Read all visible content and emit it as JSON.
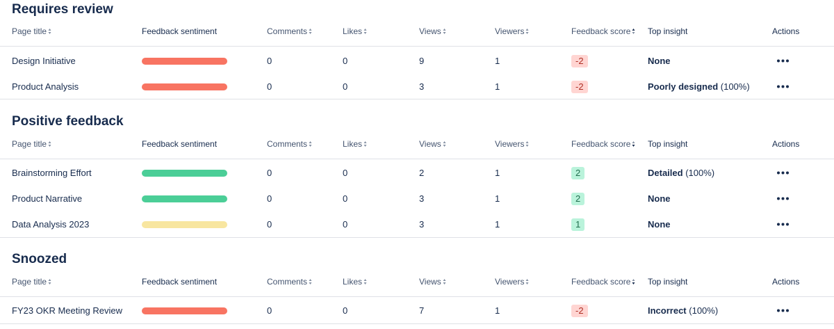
{
  "columns": {
    "page_title": "Page title",
    "feedback_sentiment": "Feedback sentiment",
    "comments": "Comments",
    "likes": "Likes",
    "views": "Views",
    "viewers": "Viewers",
    "feedback_score": "Feedback score",
    "top_insight": "Top insight",
    "actions": "Actions"
  },
  "colors": {
    "negative": "#f87462",
    "positive": "#4bce97",
    "neutral": "#f8e6a0",
    "badge_negative_bg": "#ffd5d2",
    "badge_positive_bg": "#baf3db"
  },
  "icons": {
    "sort": "sort-icon",
    "more": "more-horizontal-icon"
  },
  "sections": [
    {
      "title": "Requires review",
      "rows": [
        {
          "page_title": "Design Initiative",
          "sentiment": "negative",
          "comments": "0",
          "likes": "0",
          "views": "9",
          "viewers": "1",
          "score": "-2",
          "insight": "None",
          "insight_pct": ""
        },
        {
          "page_title": "Product Analysis",
          "sentiment": "negative",
          "comments": "0",
          "likes": "0",
          "views": "3",
          "viewers": "1",
          "score": "-2",
          "insight": "Poorly designed",
          "insight_pct": "(100%)"
        }
      ]
    },
    {
      "title": "Positive feedback",
      "rows": [
        {
          "page_title": "Brainstorming Effort",
          "sentiment": "positive",
          "comments": "0",
          "likes": "0",
          "views": "2",
          "viewers": "1",
          "score": "2",
          "insight": "Detailed",
          "insight_pct": "(100%)"
        },
        {
          "page_title": "Product Narrative",
          "sentiment": "positive",
          "comments": "0",
          "likes": "0",
          "views": "3",
          "viewers": "1",
          "score": "2",
          "insight": "None",
          "insight_pct": ""
        },
        {
          "page_title": "Data Analysis 2023",
          "sentiment": "neutral",
          "comments": "0",
          "likes": "0",
          "views": "3",
          "viewers": "1",
          "score": "1",
          "insight": "None",
          "insight_pct": ""
        }
      ]
    },
    {
      "title": "Snoozed",
      "rows": [
        {
          "page_title": "FY23 OKR Meeting Review",
          "sentiment": "negative",
          "comments": "0",
          "likes": "0",
          "views": "7",
          "viewers": "1",
          "score": "-2",
          "insight": "Incorrect",
          "insight_pct": "(100%)"
        }
      ]
    }
  ]
}
